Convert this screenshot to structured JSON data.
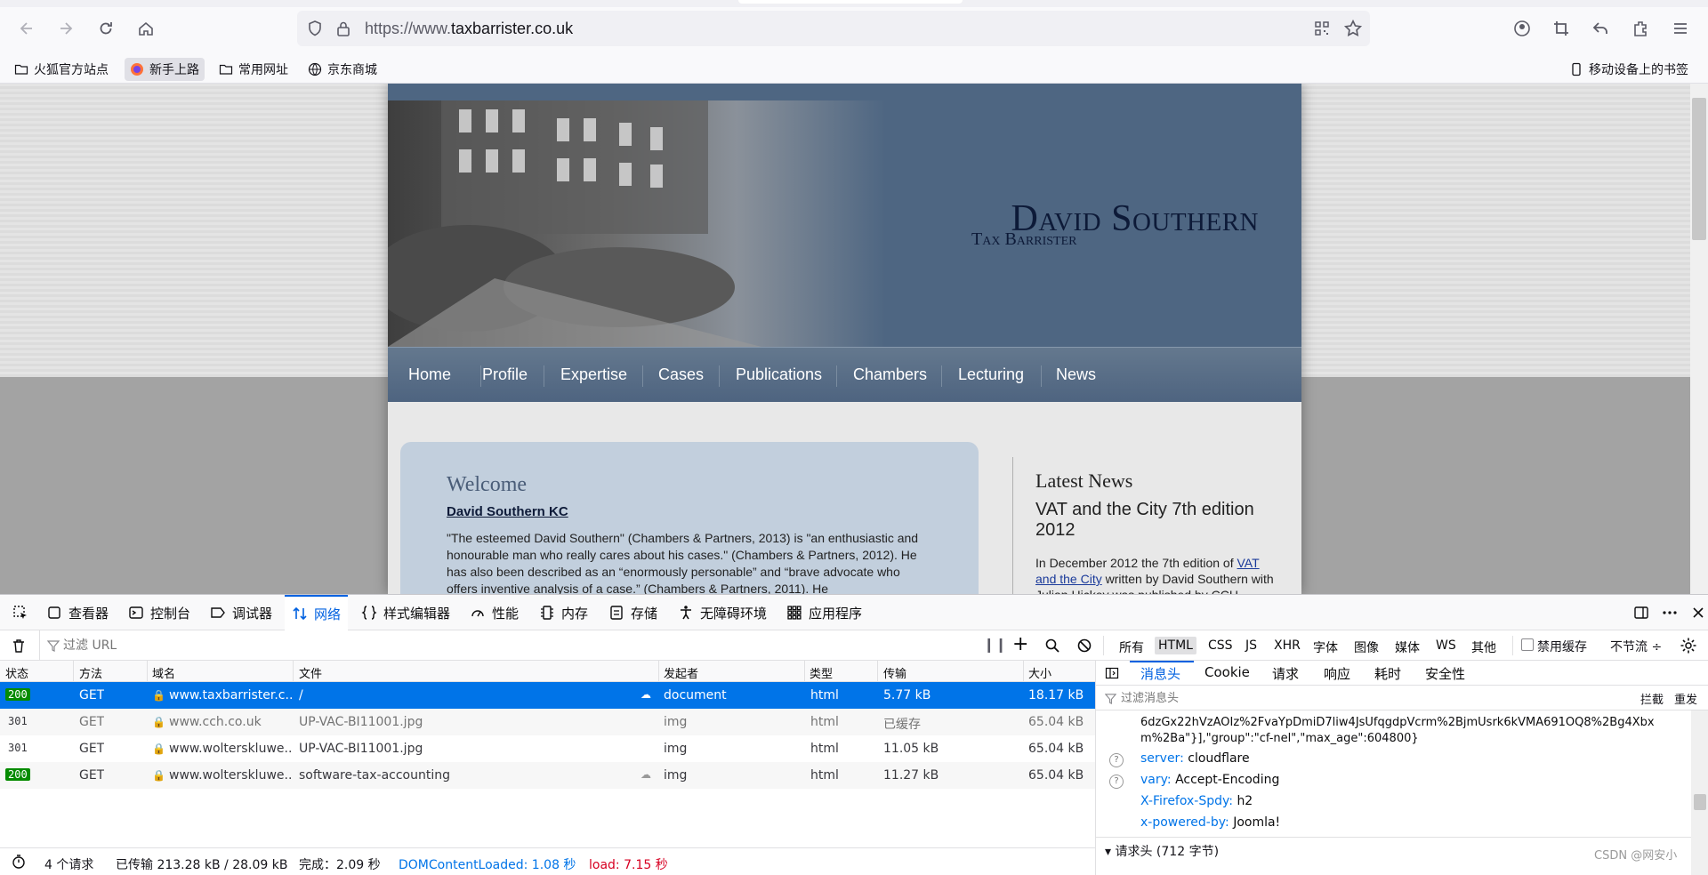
{
  "browser": {
    "url_prefix": "https://www.",
    "url_domain": "taxbarrister.co.uk",
    "bookmarks": [
      "火狐官方站点",
      "新手上路",
      "常用网址",
      "京东商城"
    ],
    "mobile_bookmarks": "移动设备上的书签"
  },
  "site": {
    "brand_name": "David Southern",
    "brand_sub": "Tax Barrister",
    "nav": [
      "Home",
      "Profile",
      "Expertise",
      "Cases",
      "Publications",
      "Chambers",
      "Lecturing",
      "News"
    ],
    "welcome_title": "Welcome",
    "welcome_sub": "David Southern KC",
    "welcome_text": "\"The esteemed David Southern\" (Chambers & Partners, 2013) is \"an enthusiastic and honourable man who really cares about his cases.\" (Chambers & Partners, 2012). He has also been described as an “enormously personable” and “brave advocate who offers inventive analysis of a case.” (Chambers & Partners, 2011). He",
    "news_title": "Latest News",
    "news_item": "VAT and the City 7th edition 2012",
    "news_text_pre": "In December 2012 the 7th edition of ",
    "news_link": "VAT and the City",
    "news_text_post": " written by David Southern with Julian Hickey was published by CCH"
  },
  "devtools": {
    "tabs": [
      "查看器",
      "控制台",
      "调试器",
      "网络",
      "样式编辑器",
      "性能",
      "内存",
      "存储",
      "无障碍环境",
      "应用程序"
    ],
    "filter_placeholder": "过滤 URL",
    "filter_types": [
      "所有",
      "HTML",
      "CSS",
      "JS",
      "XHR",
      "字体",
      "图像",
      "媒体",
      "WS",
      "其他"
    ],
    "disable_cache": "禁用缓存",
    "throttle": "不节流 ÷",
    "columns": [
      "状态",
      "方法",
      "域名",
      "文件",
      "发起者",
      "类型",
      "传输",
      "大小"
    ],
    "requests": [
      {
        "status": "200",
        "method": "GET",
        "domain": "www.taxbarrister.c...",
        "file": "/",
        "initiator": "document",
        "type": "html",
        "transfer": "5.77 kB",
        "size": "18.17 kB"
      },
      {
        "status": "301",
        "method": "GET",
        "domain": "www.cch.co.uk",
        "file": "UP-VAC-BI11001.jpg",
        "initiator": "img",
        "type": "html",
        "transfer": "已缓存",
        "size": "65.04 kB"
      },
      {
        "status": "301",
        "method": "GET",
        "domain": "www.wolterskluwe...",
        "file": "UP-VAC-BI11001.jpg",
        "initiator": "img",
        "type": "html",
        "transfer": "11.05 kB",
        "size": "65.04 kB"
      },
      {
        "status": "200",
        "method": "GET",
        "domain": "www.wolterskluwe...",
        "file": "software-tax-accounting",
        "initiator": "img",
        "type": "html",
        "transfer": "11.27 kB",
        "size": "65.04 kB"
      }
    ],
    "status_bar": {
      "requests": "4 个请求",
      "transferred": "已传输 213.28 kB / 28.09 kB",
      "finish": "完成：2.09 秒",
      "dcl": "DOMContentLoaded: 1.08 秒",
      "load": "load: 7.15 秒"
    },
    "panel_tabs": [
      "消息头",
      "Cookie",
      "请求",
      "响应",
      "耗时",
      "安全性"
    ],
    "panel_filter": "过滤消息头",
    "panel_block": "拦截",
    "panel_resend": "重发",
    "headers_cont1": "6dzGx22hVzAOIz%2FvaYpDmiD7liw4JsUfqgdpVcrm%2BjmUsrk6kVMA691OQ8%2Bg4Xbx",
    "headers_cont2": "m%2Ba\"}],\"group\":\"cf-nel\",\"max_age\":604800}",
    "headers": [
      {
        "key": "server:",
        "value": "cloudflare"
      },
      {
        "key": "vary:",
        "value": "Accept-Encoding"
      },
      {
        "key": "X-Firefox-Spdy:",
        "value": "h2"
      },
      {
        "key": "x-powered-by:",
        "value": "Joomla!"
      }
    ],
    "request_headers": "请求头 (712 字节)",
    "watermark": "CSDN @网安小"
  },
  "colors": {
    "accent": "#0074e8",
    "status_ok": "#058b00",
    "header_blue": "#4e6682"
  }
}
